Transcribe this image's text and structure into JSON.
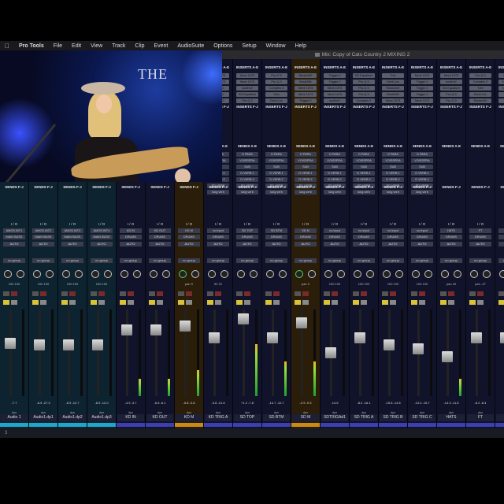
{
  "menubar": {
    "app_name": "Pro Tools",
    "items": [
      "File",
      "Edit",
      "View",
      "Track",
      "Clip",
      "Event",
      "AudioSuite",
      "Options",
      "Setup",
      "Window",
      "Help"
    ]
  },
  "window_title": "Mix: Copy of Cats Country 2 MIXING 2",
  "labels": {
    "inserts": "INSERTS A-E",
    "inserts2": "INSERTS F-J",
    "sends": "SENDS A-E",
    "sends2": "SENDS F-J",
    "io": "I / O",
    "auto": "AUTO",
    "group": "no group",
    "dyn": "dyn"
  },
  "tracks": [
    {
      "name": "Audio 1",
      "type": "aux",
      "input": "AMOS.INT1",
      "output": "MAIN BUSS",
      "vol": "-7.7",
      "fader": 0.62,
      "meter": 0.0,
      "pan": "100 100",
      "color": "#1fa6c9"
    },
    {
      "name": "Audio1.dp1",
      "type": "aux",
      "input": "AMOS.INT2",
      "output": "MAIN BUSS",
      "vol": "-6.9  -27.3",
      "fader": 0.6,
      "meter": 0.0,
      "pan": "100 100",
      "color": "#1fa6c9"
    },
    {
      "name": "Audio1.dp2",
      "type": "aux",
      "input": "AMOS.INT3",
      "output": "MAIN BUSS",
      "vol": "-6.9  -12.7",
      "fader": 0.6,
      "meter": 0.0,
      "pan": "100 100",
      "color": "#1fa6c9"
    },
    {
      "name": "Audio1.dp3",
      "type": "aux",
      "input": "AMOS.INT4",
      "output": "MAIN BUSS",
      "vol": "-6.9  -12.0",
      "fader": 0.6,
      "meter": 0.0,
      "pan": "100 100",
      "color": "#1fa6c9"
    },
    {
      "name": "KD IN",
      "type": "normal",
      "input": "KD IN",
      "output": "DRUMS",
      "vol": "-4.9  -3.7",
      "fader": 0.8,
      "meter": 0.2,
      "pan": "",
      "color": "#3d3fb0"
    },
    {
      "name": "KD OUT",
      "type": "normal",
      "input": "KD OUT",
      "output": "DRUMS",
      "vol": "-6.6  -6.1",
      "fader": 0.8,
      "meter": 0.2,
      "pan": "",
      "color": "#3d3fb0"
    },
    {
      "name": "KD M",
      "type": "master",
      "input": "KD M",
      "output": "DRUMS",
      "vol": "-5.8  -0.8",
      "fader": 0.85,
      "meter": 0.3,
      "pan": "pan  0",
      "color": "#c88a18"
    },
    {
      "name": "KD TRIG A",
      "type": "normal",
      "input": "no input",
      "output": "DRUMS",
      "vol": "-3.8  -21.6",
      "fader": 0.7,
      "meter": 0.0,
      "pan": "52  22",
      "color": "#3d3fb0"
    },
    {
      "name": "SD TOP",
      "type": "normal",
      "input": "SD TOP",
      "output": "DRUMS",
      "vol": "+1.2  -7.8",
      "fader": 0.95,
      "meter": 0.6,
      "pan": "",
      "color": "#3d3fb0"
    },
    {
      "name": "SD BTM",
      "type": "normal",
      "input": "SD BTM",
      "output": "DRUMS",
      "vol": "-14.7  -10.7",
      "fader": 0.7,
      "meter": 0.4,
      "pan": "",
      "color": "#3d3fb0"
    },
    {
      "name": "SD M",
      "type": "master",
      "input": "SD M",
      "output": "DRUMS",
      "vol": "-2.9  -9.3",
      "fader": 0.9,
      "meter": 0.4,
      "pan": "pan  0",
      "color": "#c88a18"
    },
    {
      "name": "SDTRIGAd1",
      "type": "normal",
      "input": "no input",
      "output": "DRUMS",
      "vol": "-14.6",
      "fader": 0.5,
      "meter": 0.0,
      "pan": "100 100",
      "color": "#3d3fb0"
    },
    {
      "name": "SD TRIG A",
      "type": "normal",
      "input": "no input",
      "output": "DRUMS",
      "vol": "-8.2  -16.1",
      "fader": 0.7,
      "meter": 0.0,
      "pan": "100 100",
      "color": "#3d3fb0"
    },
    {
      "name": "SD TRIG B",
      "type": "normal",
      "input": "no input",
      "output": "DRUMS",
      "vol": "-15.8  -14.8",
      "fader": 0.6,
      "meter": 0.0,
      "pan": "100 100",
      "color": "#3d3fb0"
    },
    {
      "name": "SD TRIG C",
      "type": "normal",
      "input": "no input",
      "output": "DRUMS",
      "vol": "-13.4  -15.7",
      "fader": 0.55,
      "meter": 0.0,
      "pan": "100 100",
      "color": "#3d3fb0"
    },
    {
      "name": "HATS",
      "type": "normal",
      "input": "HATS",
      "output": "DRUMS",
      "vol": "-14.3  -11.8",
      "fader": 0.45,
      "meter": 0.2,
      "pan": "pan  40",
      "color": "#3d3fb0"
    },
    {
      "name": "FT",
      "type": "normal",
      "input": "FT",
      "output": "DRUMS",
      "vol": "-8.2  -8.4",
      "fader": 0.7,
      "meter": 0.0,
      "pan": "pan  -47",
      "color": "#3d3fb0"
    },
    {
      "name": "FT",
      "type": "normal",
      "input": "FT",
      "output": "DRUMS",
      "vol": "-8.2",
      "fader": 0.7,
      "meter": 0.0,
      "pan": "",
      "color": "#3d3fb0"
    }
  ],
  "inserts_plugins": [
    "Neve 1073",
    "Neve 1073",
    "Trigger 2",
    "Trigger 2",
    "Trigger 2",
    "Neve 1073",
    "Neve 1073",
    "soothe2",
    "SD Equalizer",
    "Pro-Q 3",
    "Pro-G 3",
    "Pro-Q 3",
    "Comptes 3",
    "Trim",
    "Devil-Loc",
    "Radar440",
    "BusAB/B"
  ],
  "sends_list": [
    "D PARA",
    "VOISSPRA",
    "SUB",
    "D VERB 1",
    "D VERB 2",
    "SD VERB",
    "long verb"
  ],
  "status_bar": "3"
}
